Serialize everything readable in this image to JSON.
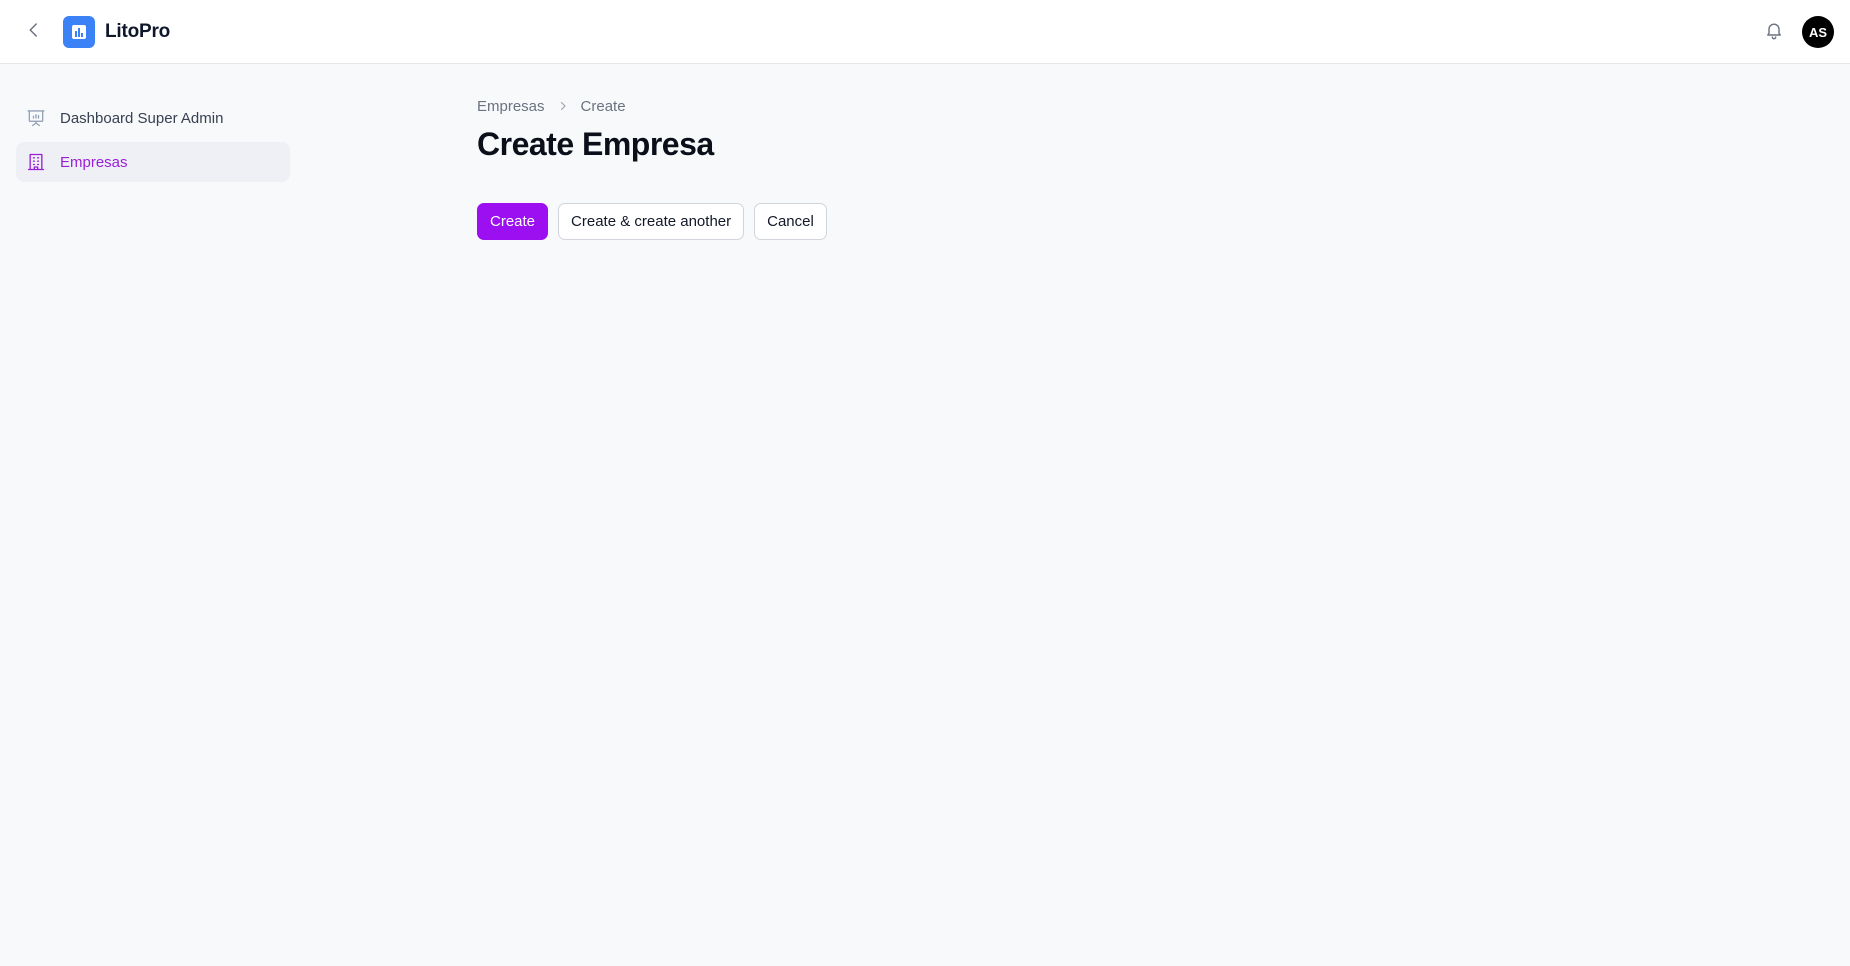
{
  "app": {
    "name": "LitoPro",
    "brand_color": "#3b82f6",
    "accent_color": "#9b0ff0"
  },
  "topbar": {
    "back_icon": "chevron-left-icon",
    "logo_icon": "bar-chart-icon",
    "notifications_icon": "bell-icon",
    "user_initials": "AS"
  },
  "sidebar": {
    "items": [
      {
        "label": "Dashboard Super Admin",
        "icon": "presentation-chart-icon",
        "active": false
      },
      {
        "label": "Empresas",
        "icon": "building-office-icon",
        "active": true
      }
    ]
  },
  "main": {
    "breadcrumb": [
      "Empresas",
      "Create"
    ],
    "title": "Create Empresa",
    "actions": {
      "create_label": "Create",
      "create_another_label": "Create & create another",
      "cancel_label": "Cancel"
    }
  }
}
